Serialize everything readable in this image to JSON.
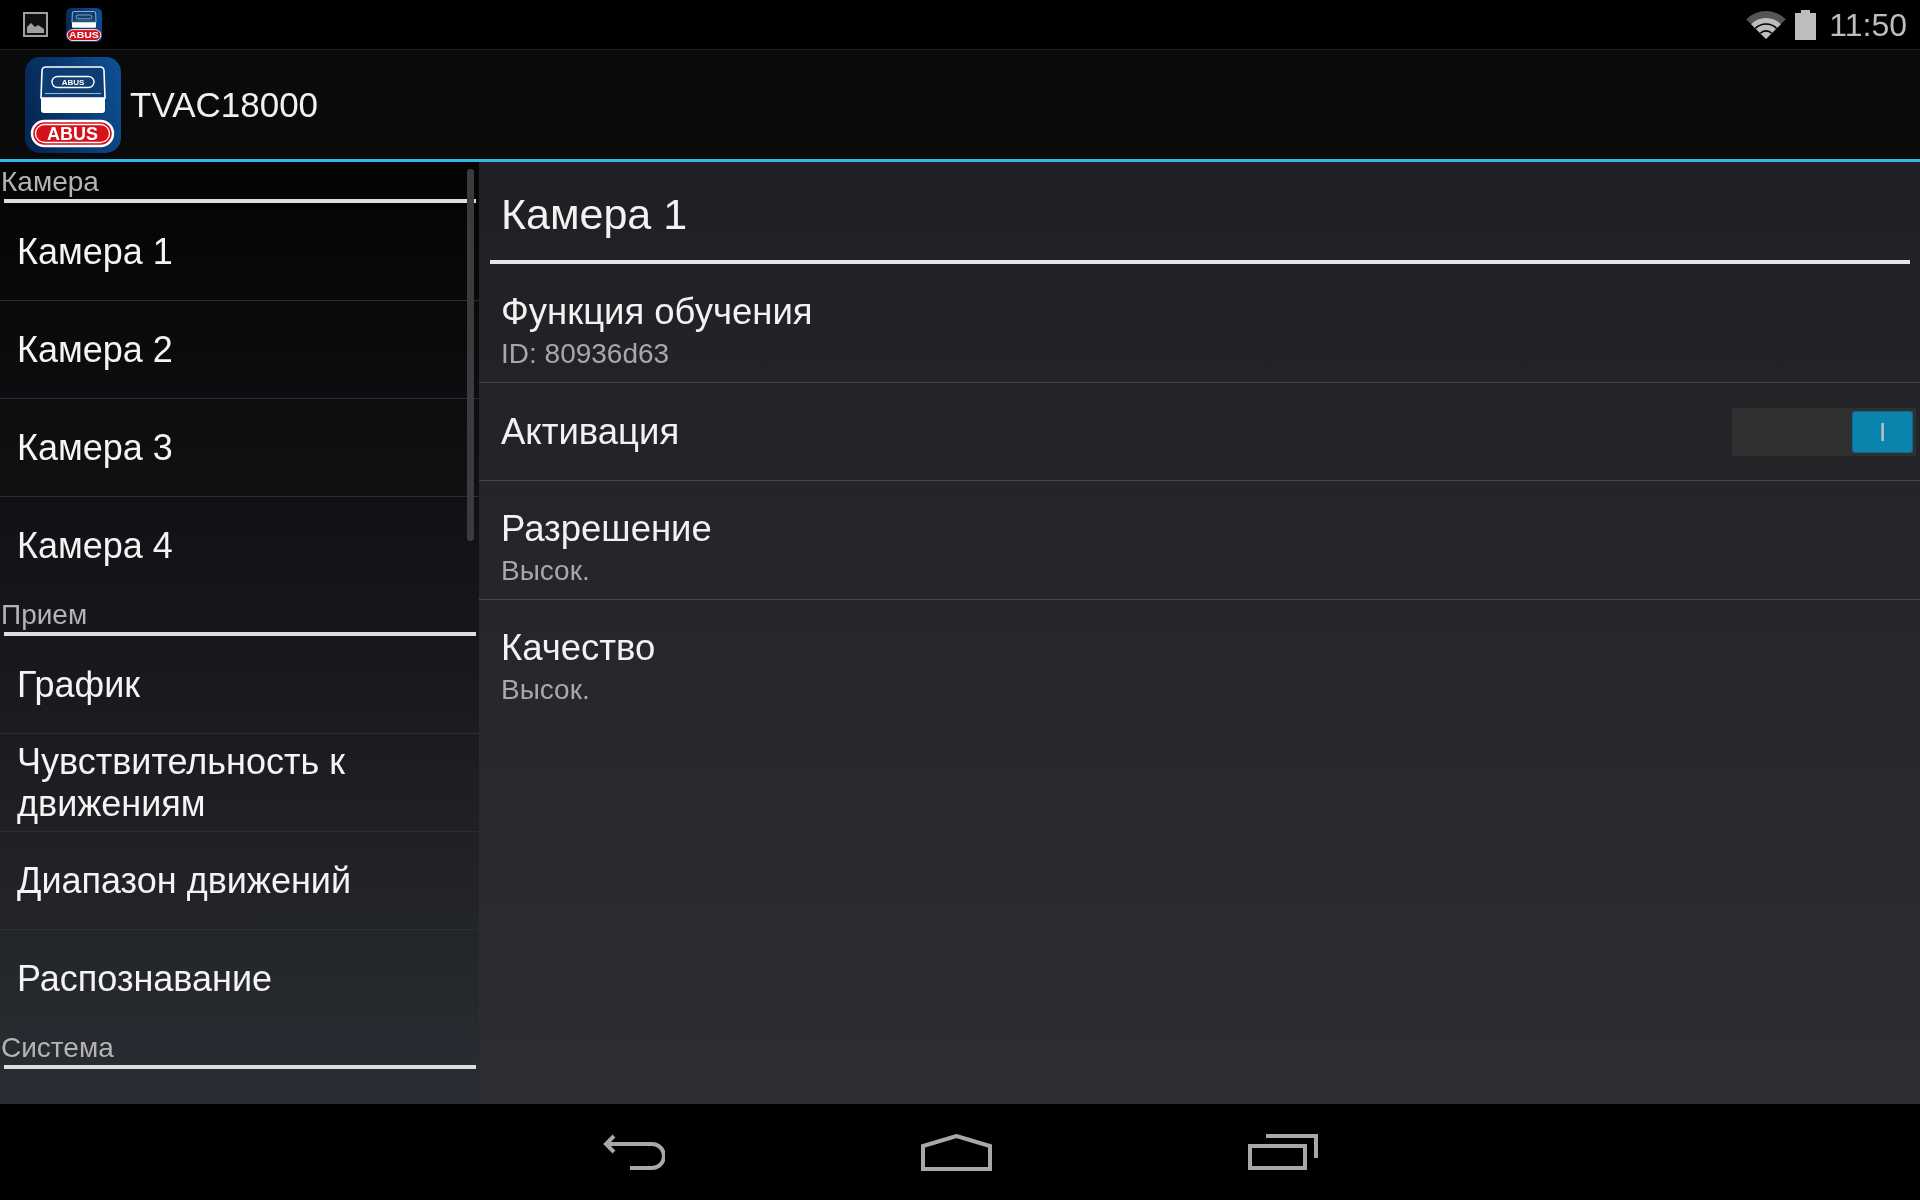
{
  "status_bar": {
    "notification_badge": "ABUS",
    "time": "11:50"
  },
  "app_bar": {
    "logo": {
      "device_label": "ABUS",
      "badge": "ABUS"
    },
    "title": "TVAC18000"
  },
  "sidebar": {
    "sections": [
      {
        "title": "Камера",
        "items": [
          "Камера 1",
          "Камера 2",
          "Камера 3",
          "Камера 4"
        ]
      },
      {
        "title": "Прием",
        "items": [
          "График",
          "Чувствительность к движениям",
          "Диапазон движений",
          "Распознавание"
        ]
      },
      {
        "title": "Система"
      }
    ]
  },
  "detail": {
    "title": "Камера 1",
    "preferences": [
      {
        "kind": "text",
        "title": "Функция обучения",
        "summary": "ID: 80936d63"
      },
      {
        "kind": "switch",
        "title": "Активация",
        "on": true,
        "thumb_label": "I"
      },
      {
        "kind": "text",
        "title": "Разрешение",
        "summary": "Высок."
      },
      {
        "kind": "text",
        "title": "Качество",
        "summary": "Высок."
      }
    ]
  }
}
